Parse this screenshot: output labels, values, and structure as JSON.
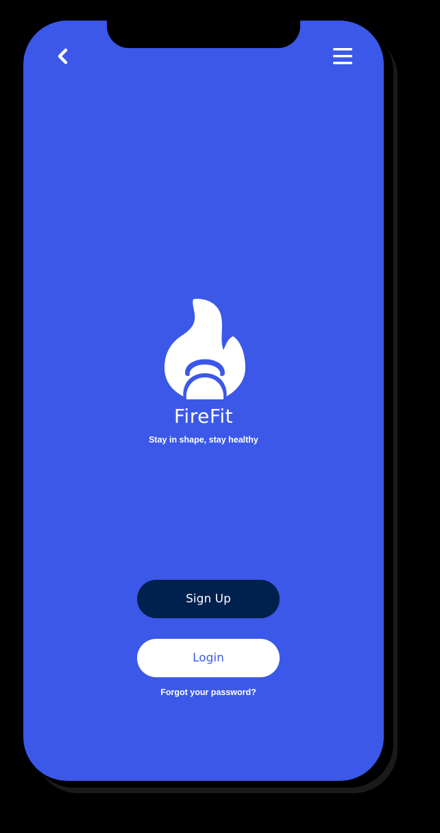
{
  "app": {
    "name": "FireFit",
    "tagline": "Stay in shape, stay healthy"
  },
  "header": {
    "back_icon": "chevron-left-icon",
    "menu_icon": "hamburger-menu-icon"
  },
  "logo": {
    "icon": "flame-kettlebell-logo"
  },
  "actions": {
    "signup_label": "Sign Up",
    "login_label": "Login",
    "forgot_label": "Forgot your password?"
  },
  "colors": {
    "background": "#3b58e8",
    "primary_button": "#00204d",
    "secondary_button": "#ffffff",
    "text_on_dark": "#ffffff"
  }
}
